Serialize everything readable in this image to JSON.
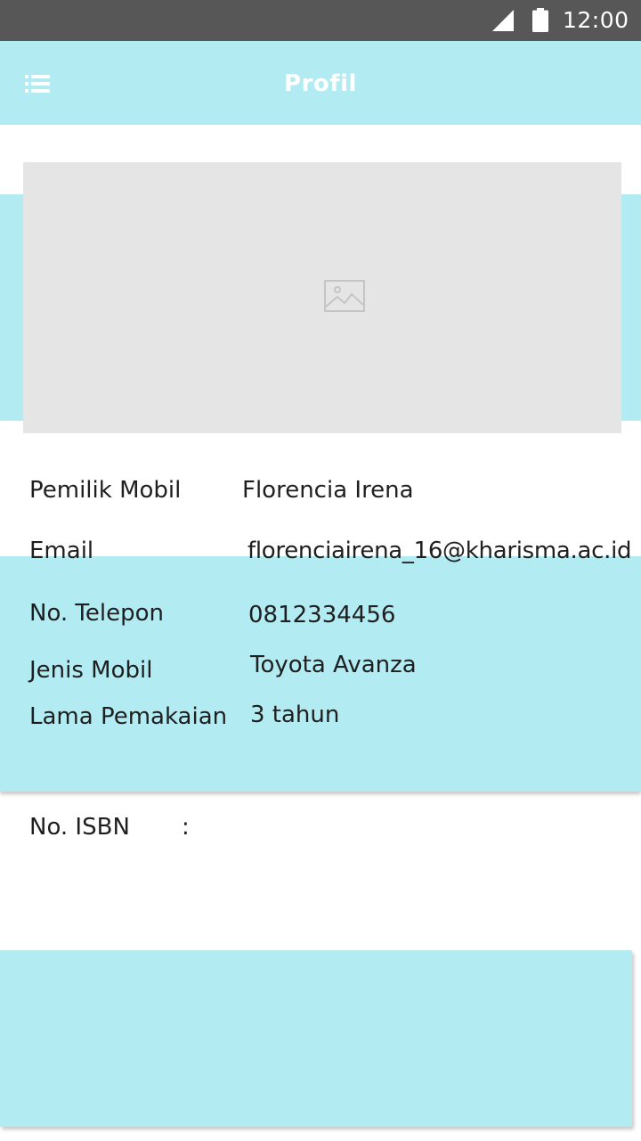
{
  "status_bar": {
    "time": "12:00",
    "icons": [
      "cellular-signal-icon",
      "battery-icon"
    ]
  },
  "app_bar": {
    "title": "Profil",
    "menu_icon": "list-menu-icon"
  },
  "profile_photo": {
    "icon": "image-placeholder-icon"
  },
  "profile": {
    "owner_label": "Pemilik Mobil",
    "owner_value": "Florencia Irena",
    "email_label": "Email",
    "email_value": "florenciairena_16@kharisma.ac.id",
    "phone_label": "No. Telepon",
    "phone_value": "0812334456",
    "car_type_label": "Jenis Mobil",
    "car_type_value": "Toyota Avanza",
    "usage_label": "Lama Pemakaian",
    "usage_value": "3 tahun",
    "isbn_label": "No. ISBN",
    "isbn_colon": ":"
  },
  "colors": {
    "accent": "#b2ebf2",
    "status_bar": "#575757",
    "photo_placeholder": "#e5e5e5",
    "text": "#1f1f1f"
  }
}
